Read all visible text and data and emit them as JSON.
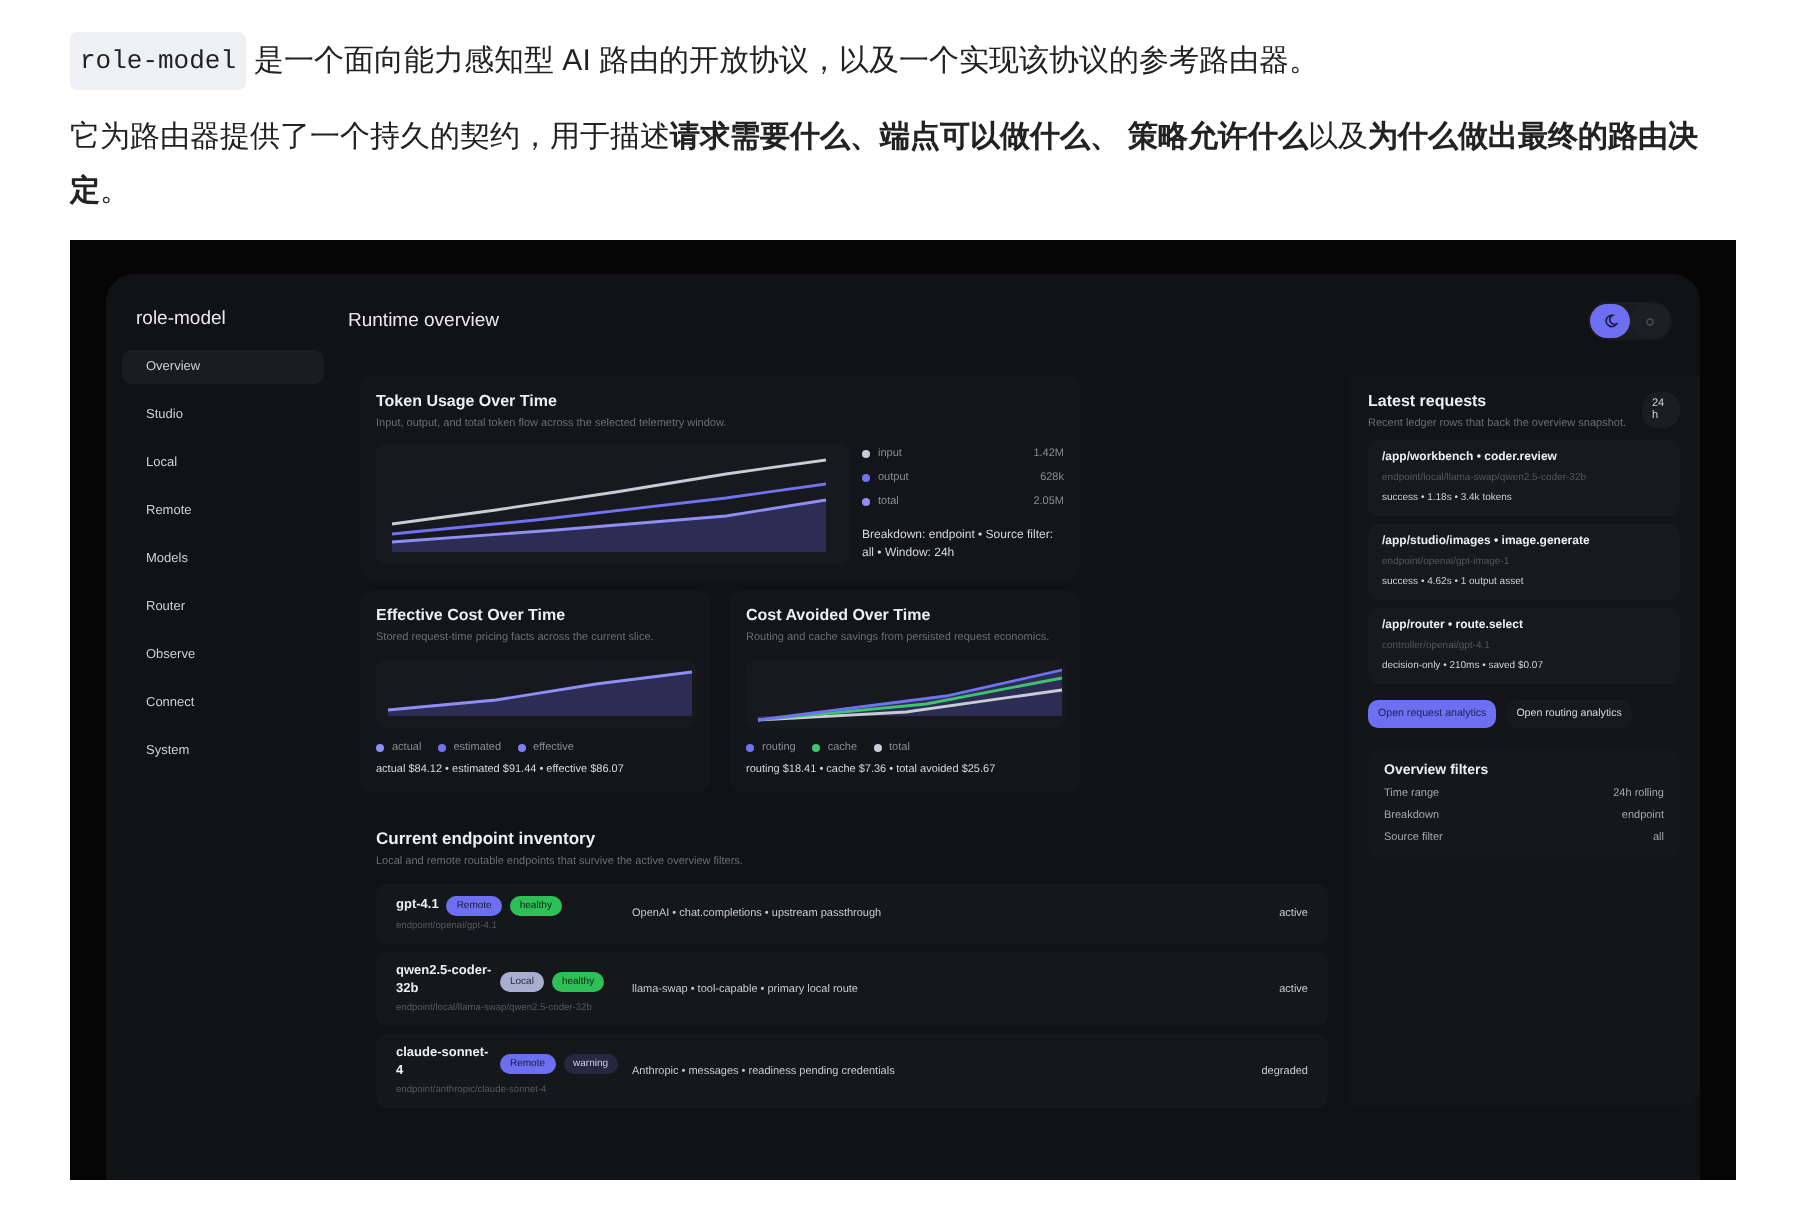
{
  "article": {
    "paragraphs": [
      {
        "code": "role-model",
        "text": "是一个面向能力感知型 AI 路由的开放协议，以及一个实现该协议的参考路由器。"
      },
      {
        "text": "它为路由器提供了一个持久的契约，用于描述**请求需要什么、端点可以做什么、 策略允许什么**以及**为什么做出最终的路由决定**。"
      }
    ]
  },
  "app": {
    "brand": "role-model",
    "nav": [
      {
        "label": "Overview",
        "selected": true
      },
      {
        "label": "Studio",
        "selected": false
      },
      {
        "label": "Local",
        "selected": false
      },
      {
        "label": "Remote",
        "selected": false
      },
      {
        "label": "Models",
        "selected": false
      },
      {
        "label": "Router",
        "selected": false
      },
      {
        "label": "Observe",
        "selected": false
      },
      {
        "label": "Connect",
        "selected": false
      },
      {
        "label": "System",
        "selected": false
      }
    ],
    "page_title": "Runtime overview",
    "theme_toggle": [
      {
        "selected": true
      },
      {
        "selected": false
      }
    ],
    "token_usage": {
      "title": "Token Usage Over Time",
      "subtitle": "Input, output, and total token flow across the selected telemetry window.",
      "legend": [
        {
          "label": "input",
          "value": "1.42M",
          "color": "#c9cbd6"
        },
        {
          "label": "output",
          "value": "628k",
          "color": "#6f73f2"
        },
        {
          "label": "total",
          "value": "2.05M",
          "color": "#8d8ff5"
        }
      ],
      "note": "Breakdown: endpoint • Source filter: all • Window: 24h"
    },
    "effective_cost": {
      "title": "Effective Cost Over Time",
      "subtitle": "Stored request-time pricing facts across the current slice.",
      "legend": [
        {
          "label": "actual",
          "color": "#8d8ff5"
        },
        {
          "label": "estimated",
          "color": "#6f73f2"
        },
        {
          "label": "effective",
          "color": "#7b7ef5"
        }
      ],
      "summary": "actual $84.12 • estimated $91.44 • effective $86.07"
    },
    "cost_avoided": {
      "title": "Cost Avoided Over Time",
      "subtitle": "Routing and cache savings from persisted request economics.",
      "legend": [
        {
          "label": "routing",
          "color": "#6f73f2"
        },
        {
          "label": "cache",
          "color": "#3ec46d"
        },
        {
          "label": "total",
          "color": "#c9cbd6"
        }
      ],
      "summary": "routing $18.41 • cache $7.36 • total avoided $25.67"
    },
    "inventory": {
      "title": "Current endpoint inventory",
      "subtitle": "Local and remote routable endpoints that survive the active overview filters.",
      "rows": [
        {
          "name": "gpt-4.1",
          "tags": [
            {
              "label": "Remote",
              "kind": "remote"
            },
            {
              "label": "healthy",
              "kind": "healthy"
            }
          ],
          "path": "endpoint/openai/gpt-4.1",
          "description": "OpenAI • chat.completions • upstream passthrough",
          "status": "active"
        },
        {
          "name": "qwen2.5-coder-32b",
          "tags": [
            {
              "label": "Local",
              "kind": "local"
            },
            {
              "label": "healthy",
              "kind": "healthy"
            }
          ],
          "path": "endpoint/local/llama-swap/qwen2.5-coder-32b",
          "description": "llama-swap • tool-capable • primary local route",
          "status": "active"
        },
        {
          "name": "claude-sonnet-4",
          "tags": [
            {
              "label": "Remote",
              "kind": "remote"
            },
            {
              "label": "warning",
              "kind": "warning"
            }
          ],
          "path": "endpoint/anthropic/claude-sonnet-4",
          "description": "Anthropic • messages • readiness pending credentials",
          "status": "degraded"
        }
      ]
    },
    "requests": {
      "title": "Latest requests",
      "subtitle": "Recent ledger rows that back the overview snapshot.",
      "badge": "24h",
      "items": [
        {
          "route": "/app/workbench • coder.review",
          "endpoint": "endpoint/local/llama-swap/qwen2.5-coder-32b",
          "summary": "success • 1.18s • 3.4k tokens"
        },
        {
          "route": "/app/studio/images • image.generate",
          "endpoint": "endpoint/openai/gpt-image-1",
          "summary": "success • 4.62s • 1 output asset"
        },
        {
          "route": "/app/router • route.select",
          "endpoint": "controller/openai/gpt-4.1",
          "summary": "decision-only • 210ms • saved $0.07"
        }
      ],
      "buttons": [
        {
          "label": "Open request analytics",
          "kind": "primary"
        },
        {
          "label": "Open routing analytics",
          "kind": "secondary"
        }
      ]
    },
    "filters": {
      "title": "Overview filters",
      "rows": [
        {
          "label": "Time range",
          "value": "24h rolling"
        },
        {
          "label": "Breakdown",
          "value": "endpoint"
        },
        {
          "label": "Source filter",
          "value": "all"
        }
      ]
    }
  }
}
